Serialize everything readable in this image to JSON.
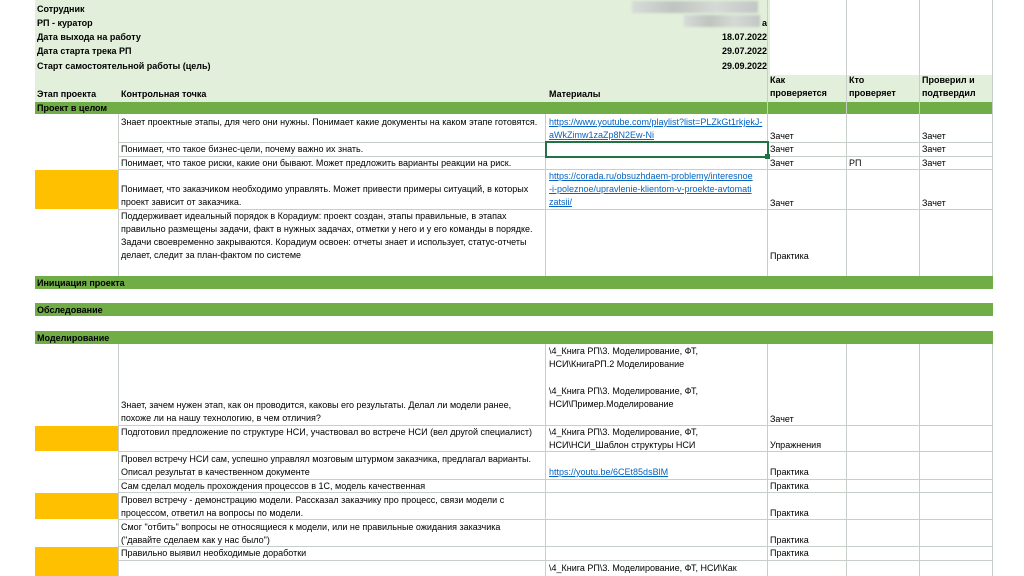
{
  "info": {
    "employee_label": "Сотрудник",
    "employee_value_suffix": "",
    "curator_label": "РП - куратор",
    "curator_value_suffix": "а",
    "start_work_label": "Дата выхода на работу",
    "start_work_date": "18.07.2022",
    "track_start_label": "Дата старта трека РП",
    "track_start_date": "29.07.2022",
    "self_work_label": "Старт самостоятельной работы (цель)",
    "self_work_date": "29.09.2022"
  },
  "columns": {
    "stage": "Этап проекта",
    "checkpoint": "Контрольная точка",
    "materials": "Материалы",
    "how": "Как проверяется",
    "who": "Кто проверяет",
    "verified": "Проверил и подтвердил"
  },
  "sections": {
    "overall": "Проект в целом",
    "initiation": "Инициация проекта",
    "survey": "Обследование",
    "modeling": "Моделирование"
  },
  "rows": [
    {
      "checkpoint": "Знает проектные этапы, для чего они нужны. Понимает какие документы на каком этапе готовятся.",
      "materials": "https://www.youtube.com/playlist?list=PLZkGt1rkjekJ-aWkZimw1zaZp8N2Ew-Ni",
      "how": "Зачет",
      "who": "",
      "verified": "Зачет"
    },
    {
      "checkpoint": "Понимает, что такое бизнес-цели, почему важно их знать.",
      "materials": "",
      "how": "Зачет",
      "who": "",
      "verified": "Зачет"
    },
    {
      "checkpoint": "Понимает, что такое риски, какие они бывают. Может предложить варианты реакции на риск.",
      "materials": "",
      "how": "Зачет",
      "who": "РП",
      "verified": "Зачет"
    },
    {
      "checkpoint": "Понимает, что заказчиком необходимо управлять. Может привести примеры ситуаций, в которых проект зависит от заказчика.",
      "materials": "https://corada.ru/obsuzhdaem-problemy/interesnoe-i-poleznoe/upravlenie-klientom-v-proekte-avtomatizatsii/",
      "how": "Зачет",
      "who": "",
      "verified": "Зачет"
    },
    {
      "checkpoint": "Поддерживает идеальный порядок в Корадиум: проект создан, этапы правильные, в этапах правильно размещены задачи, факт в нужных задачах, отметки у него и у его команды в порядке. Задачи своевременно закрываются. Корадиум освоен: отчеты знает и использует, статус-отчеты делает, следит за план-фактом по системе",
      "materials": "",
      "how": "Практика",
      "who": "",
      "verified": ""
    },
    {
      "checkpoint": "Знает, зачем нужен этап, как он проводится, каковы его результаты. Делал ли модели ранее, похоже ли на нашу технологию, в чем отличия?",
      "materials_1": "\\4_Книга РП\\3. Моделирование, ФТ, НСИ\\КнигаРП.2 Моделирование",
      "materials_2": "\\4_Книга РП\\3. Моделирование, ФТ, НСИ\\Пример.Моделирование",
      "how": "Зачет",
      "who": "",
      "verified": ""
    },
    {
      "checkpoint": "Подготовил предложение по структуре НСИ, участвовал во встрече НСИ (вел другой специалист)",
      "materials": "\\4_Книга РП\\3. Моделирование, ФТ, НСИ\\НСИ_Шаблон структуры НСИ",
      "how": "Упражнения",
      "who": "",
      "verified": ""
    },
    {
      "checkpoint": "Провел встречу НСИ сам, успешно управлял мозговым штурмом заказчика, предлагал варианты. Описал результат в качественном документе",
      "materials": "https://youtu.be/6CEt85dsBlM",
      "how": "Практика",
      "who": "",
      "verified": ""
    },
    {
      "checkpoint": "Сам сделал модель прохождения процессов в 1С, модель качественная",
      "materials": "",
      "how": "Практика",
      "who": "",
      "verified": ""
    },
    {
      "checkpoint": "Провел встречу - демонстрацию модели. Рассказал заказчику про процесс, связи модели с процессом, ответил на вопросы по модели.",
      "materials": "",
      "how": "Практика",
      "who": "",
      "verified": ""
    },
    {
      "checkpoint": "Смог \"отбить\" вопросы не относящиеся к модели, или не правильные ожидания заказчика (\"давайте сделаем как у нас было\")",
      "materials": "",
      "how": "Практика",
      "who": "",
      "verified": ""
    },
    {
      "checkpoint": "Правильно выявил необходимые доработки",
      "materials": "",
      "how": "Практика",
      "who": "",
      "verified": ""
    },
    {
      "checkpoint": "",
      "materials": "\\4_Книга РП\\3. Моделирование, ФТ, НСИ\\Как",
      "how": "",
      "who": "",
      "verified": ""
    }
  ],
  "colors": {
    "section_band": "#70ad47",
    "stage_fill": "#ffc000",
    "header_fill": "#e2efda",
    "link": "#0563c1",
    "selection": "#217346"
  }
}
